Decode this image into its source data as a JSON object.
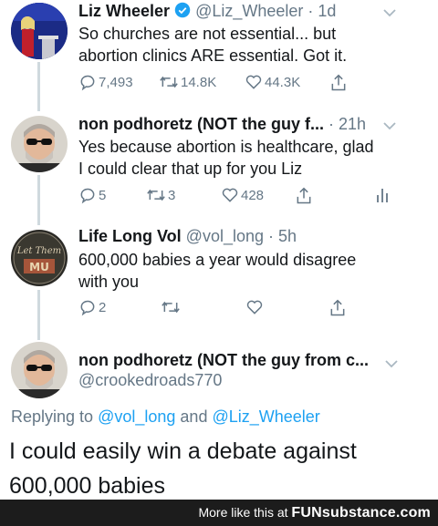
{
  "tweets": [
    {
      "name": "Liz Wheeler",
      "verified": true,
      "handle": "@Liz_Wheeler",
      "time": "· 1d",
      "text_lines": [
        "So churches are not essential... but",
        "abortion clinics ARE essential. Got it."
      ],
      "replies": "7,493",
      "retweets": "14.8K",
      "likes": "44.3K"
    },
    {
      "name": "non podhoretz (NOT the guy f...",
      "time": "· 21h",
      "text_lines": [
        "Yes because abortion is healthcare, glad",
        "I could clear that up for you Liz"
      ],
      "replies": "5",
      "retweets": "3",
      "likes": "428"
    },
    {
      "name": "Life Long Vol",
      "handle": "@vol_long",
      "time": "· 5h",
      "text_lines": [
        "600,000 babies a year would disagree",
        "with you"
      ],
      "replies": "2"
    },
    {
      "name": "non podhoretz (NOT the guy from c...",
      "handle": "@crookedroads770"
    }
  ],
  "replying": {
    "prefix": "Replying to",
    "mention1": "@vol_long",
    "and": "and",
    "mention2": "@Liz_Wheeler"
  },
  "main_text_lines": [
    "I could easily win a debate against",
    "600,000 babies"
  ],
  "footer": {
    "text": "More like this at",
    "brand": "FUNsubstance.com"
  },
  "colors": {
    "verified": "#1da1f2",
    "mention": "#1da1f2",
    "secondary": "#657786",
    "footer_bg": "#1c1c1c"
  }
}
